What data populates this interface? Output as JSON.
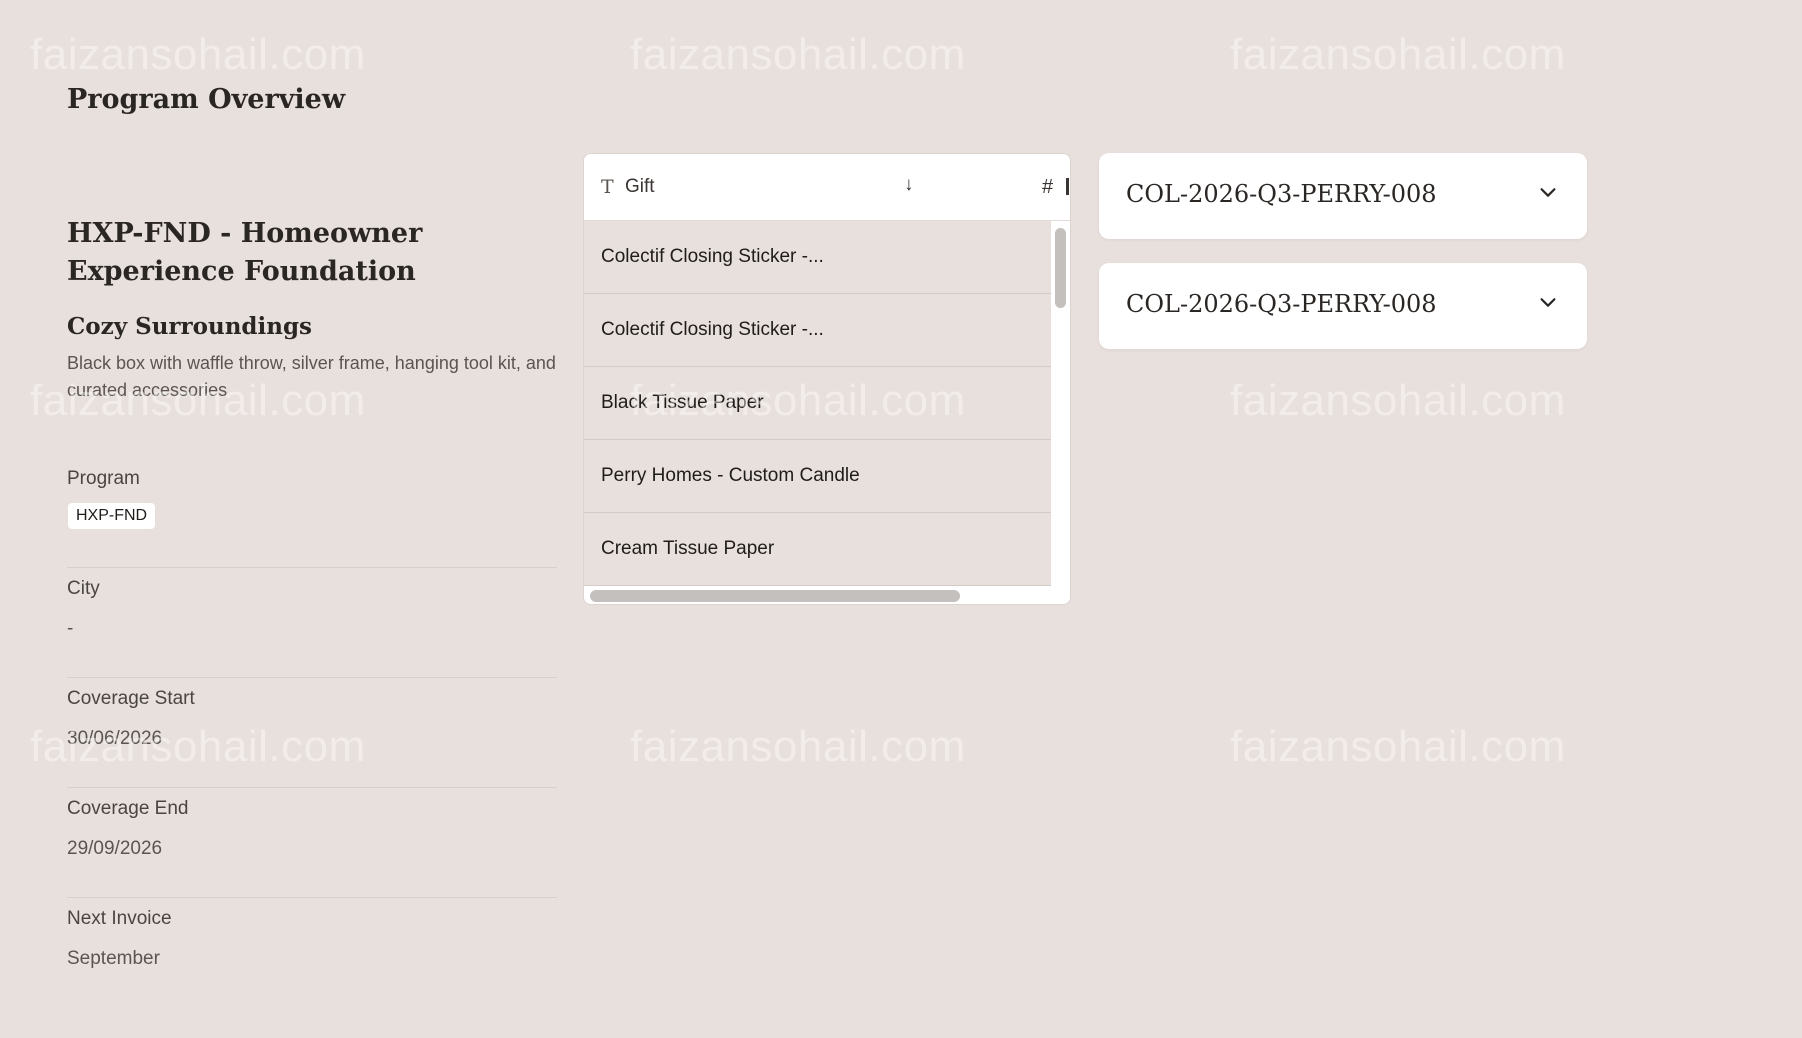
{
  "watermark": "faizansohail.com",
  "page_title": "Program Overview",
  "summary": {
    "org_name": "HXP-FND - Homeowner Experience Foundation",
    "box_name": "Cozy Surroundings",
    "box_description": "Black box with waffle throw, silver frame, hanging tool kit, and curated accessories"
  },
  "fields": {
    "program_label": "Program",
    "program_value": "HXP-FND",
    "city_label": "City",
    "city_value": "-",
    "coverage_start_label": "Coverage Start",
    "coverage_start_value": "30/06/2026",
    "coverage_end_label": "Coverage End",
    "coverage_end_value": "29/09/2026",
    "next_invoice_label": "Next Invoice",
    "next_invoice_value": "September"
  },
  "table": {
    "columns": [
      {
        "icon": "text-type-icon",
        "glyph": "T",
        "label": "Gift",
        "sort": "↓"
      },
      {
        "icon": "number-type-icon",
        "glyph": "#",
        "label": ""
      }
    ],
    "rows": [
      "Colectif Closing Sticker -...",
      "Colectif Closing Sticker -...",
      "Black Tissue Paper",
      "Perry Homes - Custom Candle",
      "Cream Tissue Paper"
    ]
  },
  "accordions": [
    {
      "title": "COL-2026-Q3-PERRY-008",
      "icon": "chevron-down-icon"
    },
    {
      "title": "COL-2026-Q3-PERRY-008",
      "icon": "chevron-down-icon"
    }
  ],
  "colors": {
    "background": "#e8e0dc",
    "card": "#ffffff",
    "text": "#2a2624",
    "muted": "#5b5552"
  }
}
